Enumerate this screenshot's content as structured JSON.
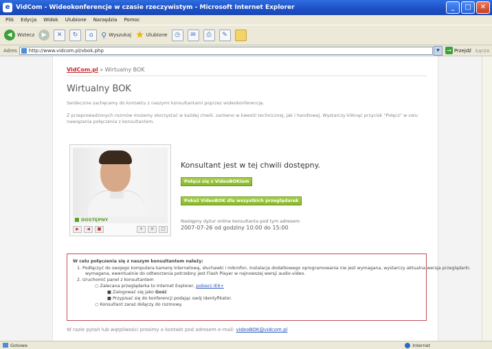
{
  "window": {
    "title": "VidCom - Wideokonferencje w czasie rzeczywistym - Microsoft Internet Explorer",
    "controls": {
      "minimize": "_",
      "maximize": "□",
      "close": "✕"
    }
  },
  "menu": [
    "Plik",
    "Edycja",
    "Widok",
    "Ulubione",
    "Narzędzia",
    "Pomoc"
  ],
  "toolbar": {
    "back_label": "Wstecz",
    "search_label": "Wyszukaj",
    "favorites_label": "Ulubione"
  },
  "address": {
    "label": "Adres",
    "url": "http://www.vidcom.pl/vbok.php",
    "go_label": "Przejdź",
    "links_label": "Łącza"
  },
  "breadcrumb": {
    "logo": "VidCom.pl",
    "separator": "»",
    "current": "Wirtualny BOK"
  },
  "heading": "Wirtualny BOK",
  "intro": "Serdecznie zachęcamy do kontaktu z naszymi konsultantami poprzez wideokonferencję.",
  "note": "Z przeprowadzonych rozmów możemy skorzystać w każdej chwili, zarówno w kwestii technicznej, jak i handlowej. Wystarczy kliknąć przycisk \"Połącz\" w celu nawiązania połączenia z konsultantem.",
  "consultant": {
    "status_badge": "DOSTĘPNY",
    "headline": "Konsultant jest w tej chwili dostępny.",
    "connect_button": "Połącz się z VideoBOKiem",
    "all_button": "Pokaż VideoBOK dla wszystkich przeglądarek",
    "hours_label": "Następny dyżur online konsultanta pod tym adresem:",
    "hours_value": "2007-07-26 od godziny 10:00 do 15:00"
  },
  "controls": {
    "video": "▶",
    "audio": "◀",
    "stop": "■",
    "c1": "+",
    "c2": "✕",
    "c3": "□"
  },
  "instructions": {
    "title": "W celu połączenia się z naszym konsultantem należy:",
    "step1": "1.  Podłączyć do swojego komputera kamerę internetową, słuchawki i mikrofon. Instalacja dodatkowego oprogramowania nie jest wymagana, wystarczy aktualna wersja przeglądarki.",
    "step1b": "wymagana, ewentualnie do odtworzenia potrzebny jest Flash Player w najnowszej wersji audio-video.",
    "step2": "2.  Uruchomić panel z konsultantem",
    "sub1_prefix": "Zalecana przeglądarka to Internet Explorer,",
    "sub1_link": "pobierz IE6+",
    "sub2_prefix": "Zalogować się jako",
    "sub2_bold": "Gość",
    "sub3": "Przypisać się do konferencji podając swój identyfikator.",
    "sub4": "Konsultant zaraz dołączy do rozmowy."
  },
  "footer": {
    "text": "W razie pytań lub wątpliwości prosimy o kontakt pod adresem e-mail:",
    "email": "videoBOK@vidcom.pl"
  },
  "statusbar": {
    "left": "Gotowe",
    "right": "Internet"
  }
}
